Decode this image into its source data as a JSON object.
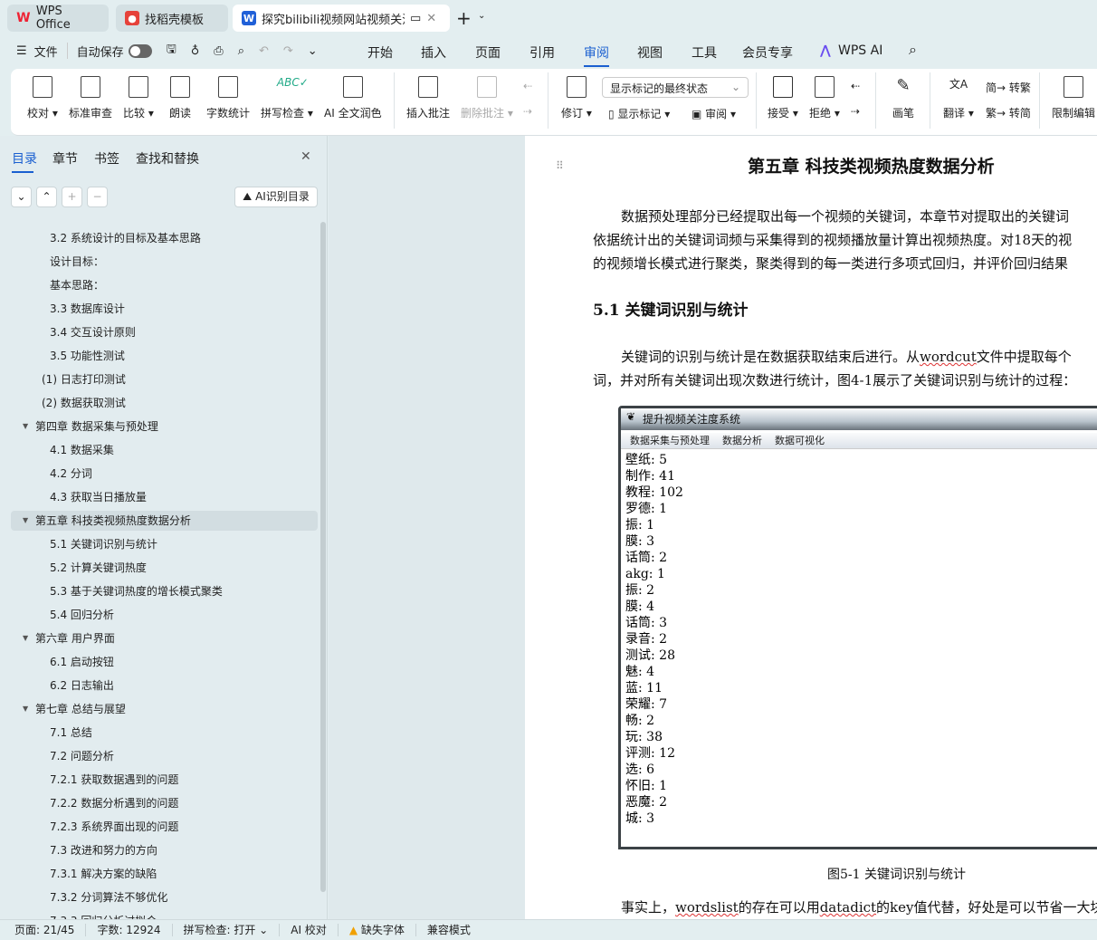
{
  "tabs": [
    {
      "label": "WPS Office",
      "icon": "wps-logo"
    },
    {
      "label": "找稻壳模板",
      "icon": "docer-logo"
    },
    {
      "label": "探究bilibili视频网站视频关注",
      "icon": "word-logo"
    }
  ],
  "menu": {
    "file": "文件",
    "autosave": "自动保存",
    "autosave_on": false,
    "tabs": [
      "开始",
      "插入",
      "页面",
      "引用",
      "审阅",
      "视图",
      "工具",
      "会员专享"
    ],
    "active_tab": "审阅",
    "wps_ai": "WPS AI"
  },
  "ribbon": {
    "buttons": [
      "校对",
      "标准审查",
      "比较",
      "朗读",
      "字数统计",
      "拼写检查",
      "AI 全文润色",
      "插入批注",
      "删除批注",
      "修订",
      "接受",
      "拒绝",
      "画笔",
      "翻译",
      "限制编辑"
    ],
    "markup_select": "显示标记的最终状态",
    "show_markup": "显示标记",
    "review": "审阅",
    "to_trad": "转繁",
    "to_simp": "转简"
  },
  "nav": {
    "tabs": [
      "目录",
      "章节",
      "书签",
      "查找和替换"
    ],
    "ai_toc": "AI识别目录",
    "items": [
      {
        "t": "3.2  系统设计的目标及基本思路",
        "l": 2
      },
      {
        "t": "设计目标：",
        "l": 2
      },
      {
        "t": "基本思路：",
        "l": 2
      },
      {
        "t": "3.3  数据库设计",
        "l": 2
      },
      {
        "t": "3.4  交互设计原则",
        "l": 2
      },
      {
        "t": "3.5  功能性测试",
        "l": 2
      },
      {
        "t": "(1)  日志打印测试",
        "l": 3
      },
      {
        "t": "(2)  数据获取测试",
        "l": 3
      },
      {
        "t": "第四章    数据采集与预处理",
        "l": 1
      },
      {
        "t": "4.1  数据采集",
        "l": 2
      },
      {
        "t": "4.2  分词",
        "l": 2
      },
      {
        "t": "4.3  获取当日播放量",
        "l": 2
      },
      {
        "t": "第五章    科技类视频热度数据分析",
        "l": 1,
        "sel": true
      },
      {
        "t": "5.1  关键词识别与统计",
        "l": 2
      },
      {
        "t": "5.2  计算关键词热度",
        "l": 2
      },
      {
        "t": "5.3  基于关键词热度的增长模式聚类",
        "l": 2
      },
      {
        "t": "5.4  回归分析",
        "l": 2
      },
      {
        "t": "第六章    用户界面",
        "l": 1
      },
      {
        "t": "6.1  启动按钮",
        "l": 2
      },
      {
        "t": "6.2  日志输出",
        "l": 2
      },
      {
        "t": "第七章    总结与展望",
        "l": 1
      },
      {
        "t": "7.1  总结",
        "l": 2
      },
      {
        "t": "7.2  问题分析",
        "l": 2
      },
      {
        "t": "7.2.1  获取数据遇到的问题",
        "l": 2
      },
      {
        "t": "7.2.2  数据分析遇到的问题",
        "l": 2
      },
      {
        "t": "7.2.3  系统界面出现的问题",
        "l": 2
      },
      {
        "t": "7.3  改进和努力的方向",
        "l": 2
      },
      {
        "t": "7.3.1  解决方案的缺陷",
        "l": 2
      },
      {
        "t": "7.3.2  分词算法不够优化",
        "l": 2
      },
      {
        "t": "7.3.3  回归分析过拟合",
        "l": 2
      }
    ]
  },
  "doc": {
    "chapter": "第五章    科技类视频热度数据分析",
    "p1": [
      "数据预处理部分已经提取出每一个视频的关键词，本章节对提取出的关键词",
      "依据统计出的关键词词频与采集得到的视频播放量计算出视频热度。对18天的视",
      "的视频增长模式进行聚类，聚类得到的每一类进行多项式回归，并评价回归结果"
    ],
    "h51": "5.1  关键词识别与统计",
    "p2a": "关键词的识别与统计是在数据获取结束后进行。从",
    "p2b": "wordcut",
    "p2c": "文件中提取每个",
    "p2line2": "词，并对所有关键词出现次数进行统计，图4-1展示了关键词识别与统计的过程：",
    "figure": {
      "window_title": "提升视频关注度系统",
      "menus": [
        "数据采集与预处理",
        "数据分析",
        "数据可视化"
      ],
      "lines": [
        "壁纸: 5",
        "制作: 41",
        "教程: 102",
        "罗德: 1",
        "振: 1",
        "膜: 3",
        "话筒: 2",
        "akg: 1",
        "振: 2",
        "膜: 4",
        "话筒: 3",
        "录音: 2",
        "测试: 28",
        "魅: 4",
        "蓝: 11",
        "荣耀: 7",
        "畅: 2",
        "玩: 38",
        "评测: 12",
        "选: 6",
        "怀旧: 1",
        "恶魔: 2",
        "城: 3"
      ]
    },
    "caption": "图5-1  关键词识别与统计",
    "p3": [
      "事实上，",
      "wordslist",
      "的存在可以用",
      "datadict",
      "的key值代替，好处是可以节省一大块"
    ]
  },
  "status": {
    "page": "页面: 21/45",
    "words": "字数: 12924",
    "spell": "拼写检查: 打开",
    "ai_check": "AI 校对",
    "missing_font": "缺失字体",
    "compat": "兼容模式"
  }
}
